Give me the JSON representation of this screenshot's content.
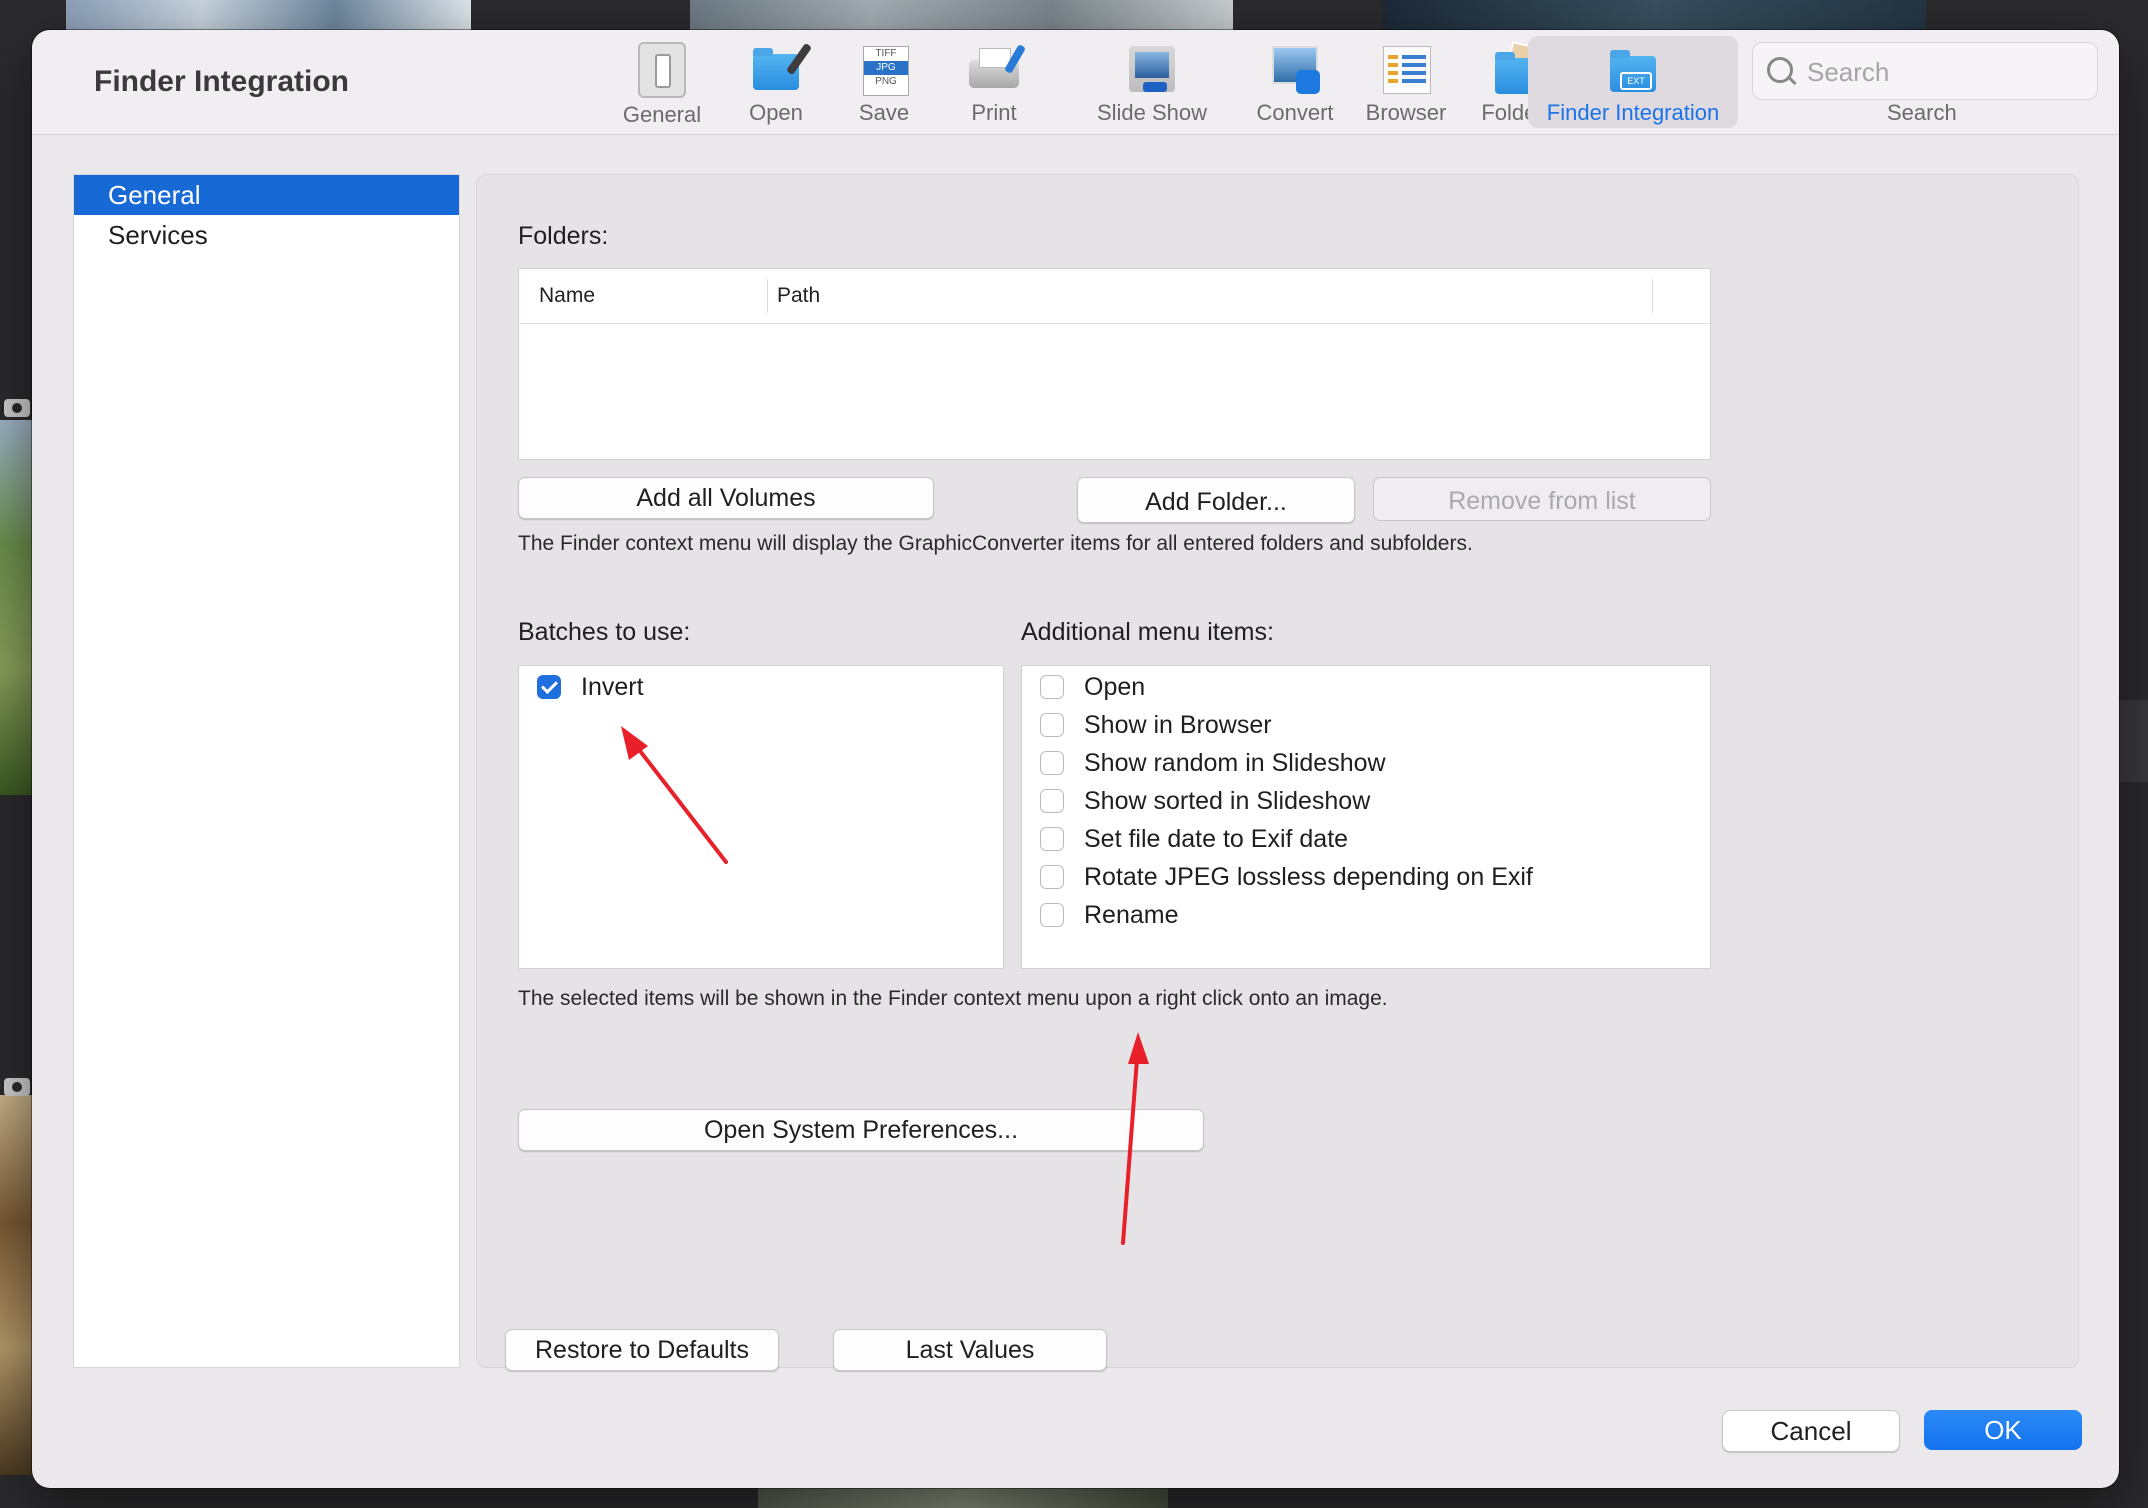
{
  "window": {
    "title": "Finder Integration"
  },
  "toolbar": {
    "items": [
      {
        "label": "General",
        "icon": "general-switch-icon"
      },
      {
        "label": "Open",
        "icon": "open-folder-icon"
      },
      {
        "label": "Save",
        "icon": "save-formats-icon"
      },
      {
        "label": "Print",
        "icon": "printer-icon"
      },
      {
        "label": "Slide Show",
        "icon": "slideshow-icon"
      },
      {
        "label": "Convert",
        "icon": "convert-icon"
      },
      {
        "label": "Browser",
        "icon": "browser-icon"
      },
      {
        "label": "Folders",
        "icon": "folders-icon"
      },
      {
        "label": "Finder Integration",
        "icon": "finder-integration-icon",
        "active": true
      }
    ],
    "save_formats": [
      "TIFF",
      "JPG",
      "PNG"
    ],
    "ext_badge": "EXT",
    "search": {
      "placeholder": "Search",
      "caption": "Search"
    }
  },
  "sidebar": {
    "items": [
      {
        "label": "General",
        "selected": true
      },
      {
        "label": "Services",
        "selected": false
      }
    ]
  },
  "main": {
    "folders_label": "Folders:",
    "table": {
      "columns": [
        "Name",
        "Path"
      ],
      "rows": []
    },
    "buttons": {
      "add_all_volumes": "Add all Volumes",
      "add_folder": "Add Folder...",
      "remove_from_list": "Remove from list"
    },
    "folders_note": "The Finder context menu will display the GraphicConverter items for all entered folders and subfolders.",
    "batches_label": "Batches to use:",
    "batches": [
      {
        "label": "Invert",
        "checked": true
      }
    ],
    "additional_label": "Additional menu items:",
    "additional_items": [
      {
        "label": "Open",
        "checked": false
      },
      {
        "label": "Show in Browser",
        "checked": false
      },
      {
        "label": "Show random in Slideshow",
        "checked": false
      },
      {
        "label": "Show sorted in Slideshow",
        "checked": false
      },
      {
        "label": "Set file date to Exif date",
        "checked": false
      },
      {
        "label": "Rotate JPEG lossless depending on Exif",
        "checked": false
      },
      {
        "label": "Rename",
        "checked": false
      }
    ],
    "selected_note": "The selected items will be shown in the Finder context menu upon a right click onto an image.",
    "open_system_prefs": "Open System Preferences...",
    "restore_defaults": "Restore to Defaults",
    "last_values": "Last Values"
  },
  "footer": {
    "cancel": "Cancel",
    "ok": "OK"
  },
  "colors": {
    "accent": "#1769d6",
    "annotation_arrow": "#e8202a"
  }
}
